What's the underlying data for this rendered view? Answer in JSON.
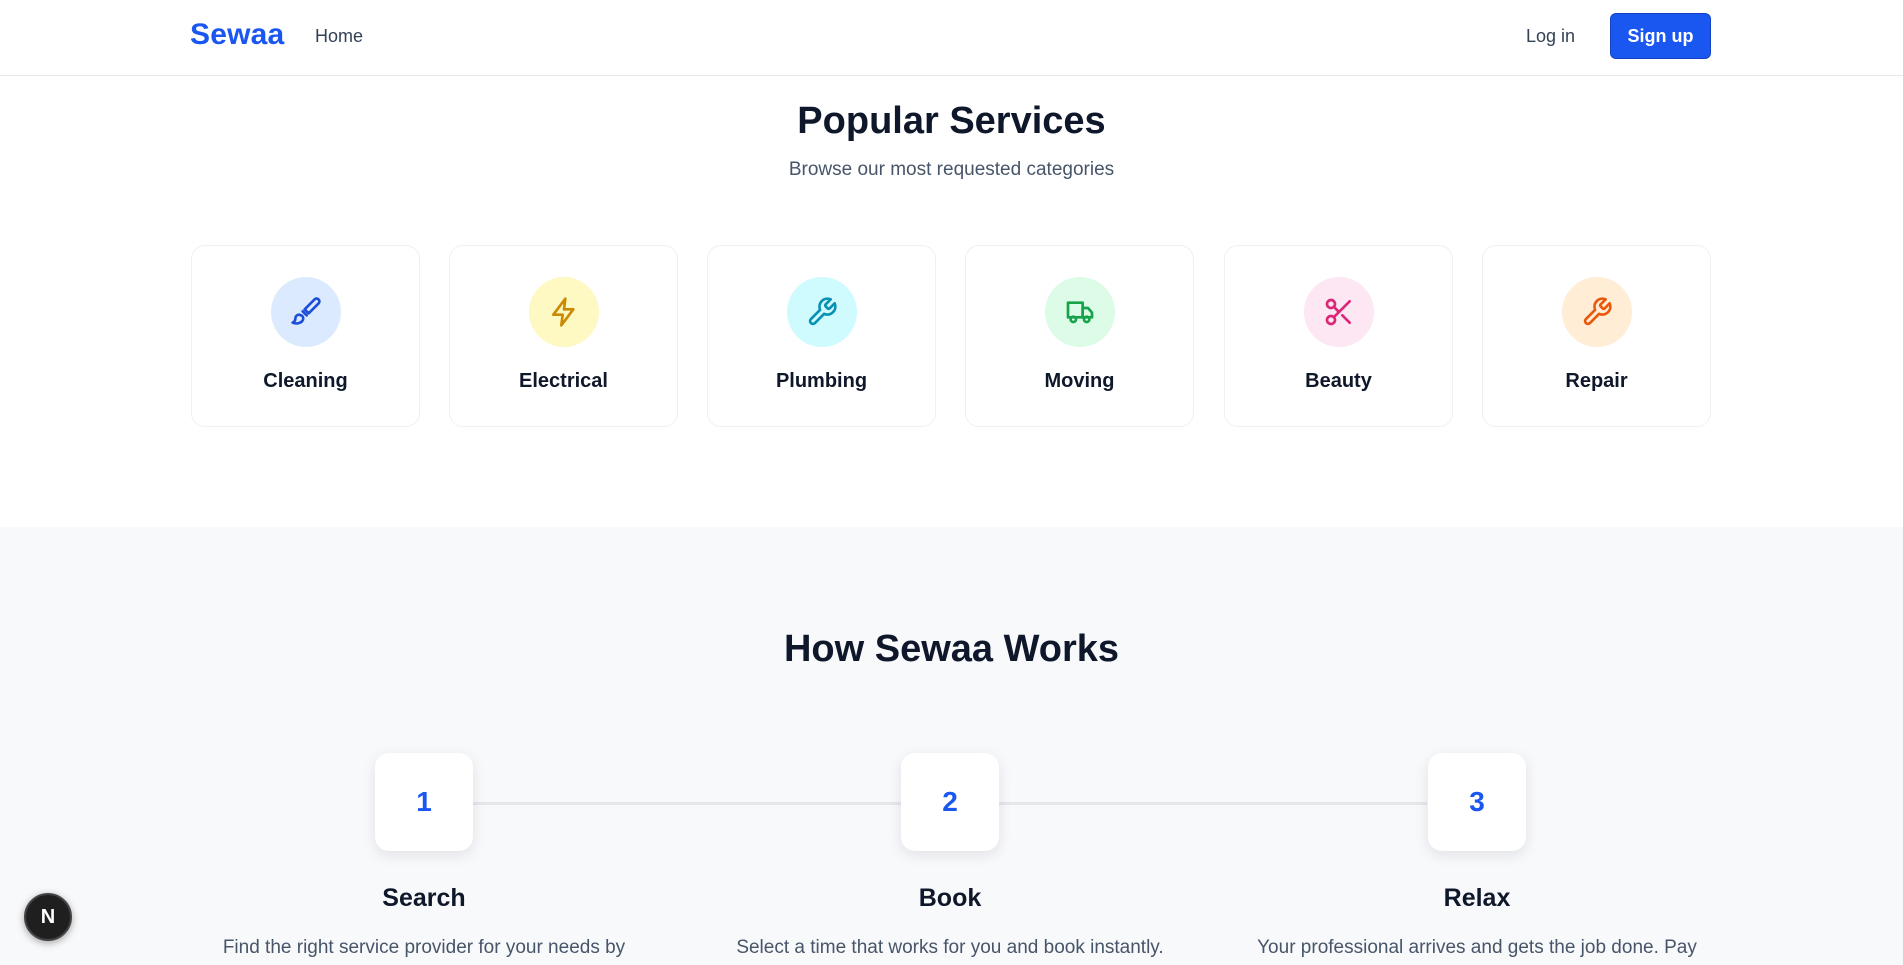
{
  "header": {
    "logo": "Sewaa",
    "nav": {
      "home": "Home"
    },
    "login_label": "Log in",
    "signup_label": "Sign up"
  },
  "services": {
    "title": "Popular Services",
    "subtitle": "Browse our most requested categories",
    "items": [
      {
        "label": "Cleaning",
        "icon": "paintbrush-icon",
        "bg": "#dbeafe",
        "color": "#1d4ed8"
      },
      {
        "label": "Electrical",
        "icon": "lightning-bolt-icon",
        "bg": "#fef9c3",
        "color": "#ca8a04"
      },
      {
        "label": "Plumbing",
        "icon": "wrench-icon",
        "bg": "#cffafe",
        "color": "#0891b2"
      },
      {
        "label": "Moving",
        "icon": "truck-icon",
        "bg": "#dcfce7",
        "color": "#16a34a"
      },
      {
        "label": "Beauty",
        "icon": "scissors-icon",
        "bg": "#fce7f3",
        "color": "#db2777"
      },
      {
        "label": "Repair",
        "icon": "wrench-icon",
        "bg": "#ffedd5",
        "color": "#ea580c"
      }
    ]
  },
  "how": {
    "title": "How Sewaa Works",
    "steps": [
      {
        "number": "1",
        "title": "Search",
        "desc": "Find the right service provider for your needs by"
      },
      {
        "number": "2",
        "title": "Book",
        "desc": "Select a time that works for you and book instantly."
      },
      {
        "number": "3",
        "title": "Relax",
        "desc": "Your professional arrives and gets the job done. Pay"
      }
    ]
  },
  "badge": {
    "label": "N"
  },
  "colors": {
    "brand": "#1a56f0",
    "text": "#0f172a",
    "muted": "#475569",
    "section_bg": "#f8f9fb"
  }
}
